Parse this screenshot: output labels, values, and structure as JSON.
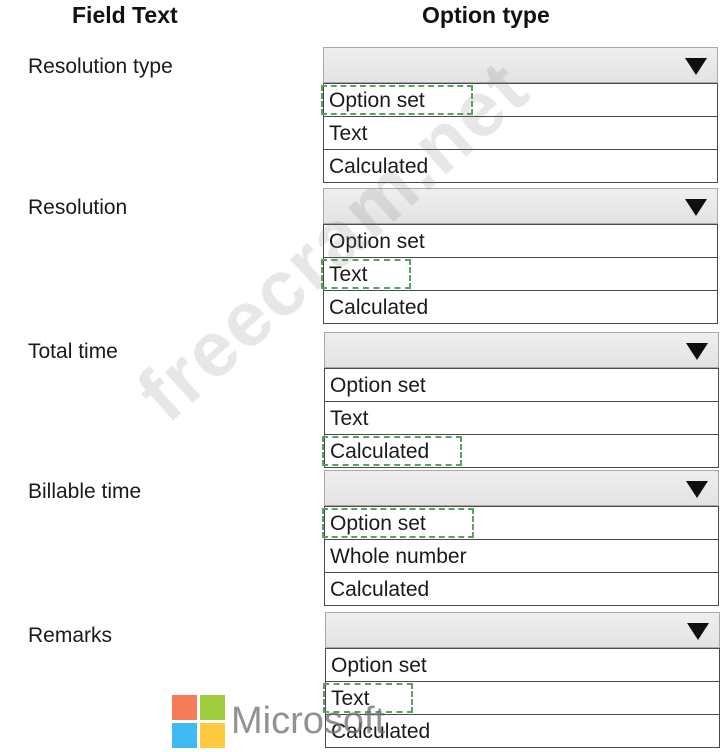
{
  "headers": {
    "field_text": "Field Text",
    "option_type": "Option type"
  },
  "rows": [
    {
      "label": "Resolution type",
      "options": [
        "Option set",
        "Text",
        "Calculated"
      ],
      "selected": "Option set"
    },
    {
      "label": "Resolution",
      "options": [
        "Option set",
        "Text",
        "Calculated"
      ],
      "selected": "Text"
    },
    {
      "label": "Total time",
      "options": [
        "Option set",
        "Text",
        "Calculated"
      ],
      "selected": "Calculated"
    },
    {
      "label": "Billable time",
      "options": [
        "Option set",
        "Whole number",
        "Calculated"
      ],
      "selected": "Option set"
    },
    {
      "label": "Remarks",
      "options": [
        "Option set",
        "Text",
        "Calculated"
      ],
      "selected": "Text"
    }
  ],
  "watermark": "freecram.net",
  "logo": {
    "text": "Microsoft",
    "colors": [
      "#f25022",
      "#7fba00",
      "#00a4ef",
      "#ffb900"
    ]
  },
  "colors": {
    "selection_border": "#5aa25f",
    "dropdown_bg": "#e8e8e8"
  }
}
